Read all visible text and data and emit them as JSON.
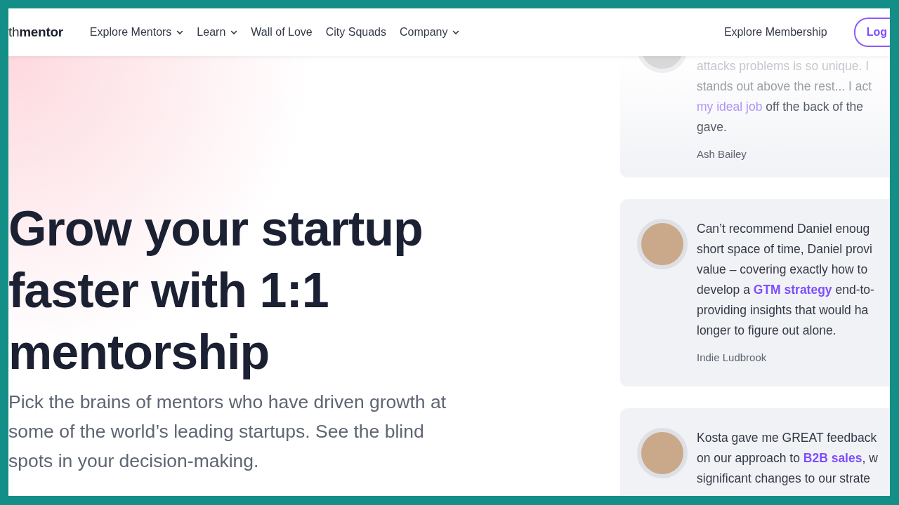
{
  "header": {
    "logo": "th**mentor**",
    "nav": [
      {
        "label": "Explore Mentors",
        "has_menu": true
      },
      {
        "label": "Learn",
        "has_menu": true
      },
      {
        "label": "Wall of Love",
        "has_menu": false
      },
      {
        "label": "City Squads",
        "has_menu": false
      },
      {
        "label": "Company",
        "has_menu": true
      }
    ],
    "membership_link": "Explore Membership",
    "login_button": "Log"
  },
  "hero": {
    "heading": "Grow your startup faster with 1:1 mentorship",
    "subheading": "Pick the brains of mentors who have driven growth at some of the world’s leading startups. See the blind spots in your decision-making."
  },
  "testimonials": [
    {
      "lines": [
        [
          {
            "kind": "text",
            "text": "attacks problems is so unique. I"
          }
        ],
        [
          {
            "kind": "text",
            "text": "stands out above the rest... I act"
          }
        ],
        [
          {
            "kind": "link",
            "text": "my ideal job"
          },
          {
            "kind": "text",
            "text": " off the back of the"
          }
        ],
        [
          {
            "kind": "text",
            "text": "gave."
          }
        ]
      ],
      "author": "Ash Bailey",
      "faded": true
    },
    {
      "lines": [
        [
          {
            "kind": "text",
            "text": "Can’t recommend Daniel enoug"
          }
        ],
        [
          {
            "kind": "text",
            "text": "short space of time, Daniel provi"
          }
        ],
        [
          {
            "kind": "text",
            "text": "value – covering exactly how to"
          }
        ],
        [
          {
            "kind": "text",
            "text": "develop a "
          },
          {
            "kind": "link",
            "text": "GTM strategy"
          },
          {
            "kind": "text",
            "text": " end-to-"
          }
        ],
        [
          {
            "kind": "text",
            "text": "providing insights that would ha"
          }
        ],
        [
          {
            "kind": "text",
            "text": "longer to figure out alone."
          }
        ]
      ],
      "author": "Indie Ludbrook",
      "faded": false
    },
    {
      "lines": [
        [
          {
            "kind": "text",
            "text": "Kosta gave me GREAT feedback"
          }
        ],
        [
          {
            "kind": "text",
            "text": "on our approach to "
          },
          {
            "kind": "link",
            "text": "B2B sales"
          },
          {
            "kind": "text",
            "text": ", w"
          }
        ],
        [
          {
            "kind": "text",
            "text": "significant changes to our strate"
          }
        ]
      ],
      "faded": false
    }
  ]
}
